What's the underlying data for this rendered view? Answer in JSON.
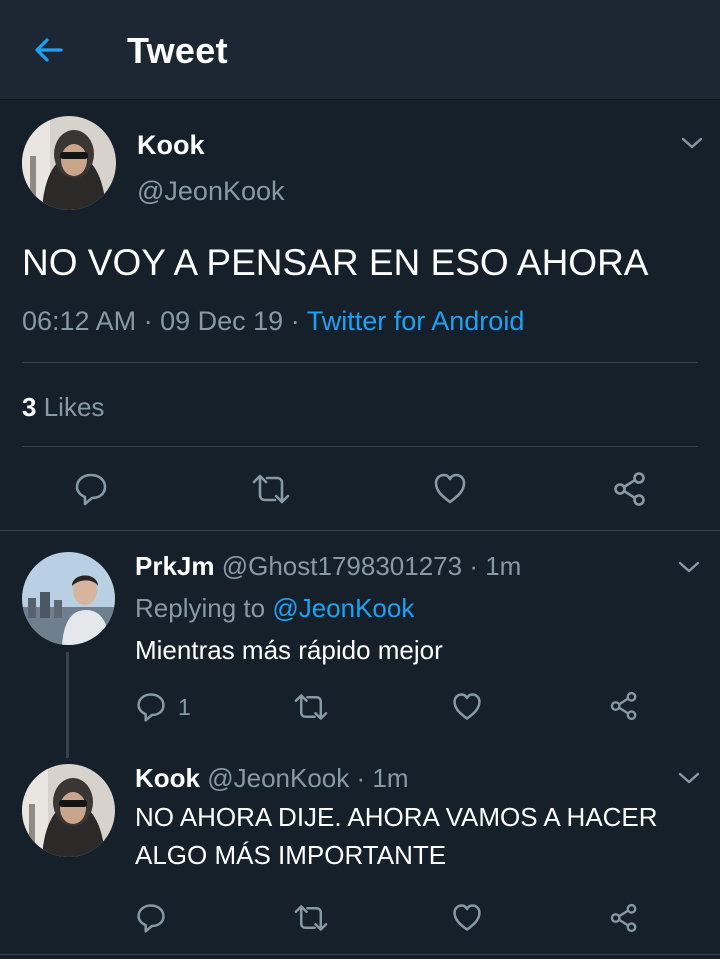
{
  "header": {
    "title": "Tweet"
  },
  "tweet": {
    "author_name": "Kook",
    "author_handle": "@JeonKook",
    "text": "NO VOY A PENSAR EN ESO AHORA",
    "time": "06:12 AM",
    "date": "09 Dec 19",
    "dot": "·",
    "source": "Twitter for Android",
    "likes_count": "3",
    "likes_label": "Likes"
  },
  "replies": [
    {
      "name": "PrkJm",
      "handle": "@Ghost1798301273",
      "age": "· 1m",
      "replying_label": "Replying to",
      "replying_to": "@JeonKook",
      "text": "Mientras más rápido mejor",
      "reply_count": "1"
    },
    {
      "name": "Kook",
      "handle": "@JeonKook",
      "age": "· 1m",
      "text_line1": "NO AHORA DIJE. AHORA VAMOS A HACER",
      "text_line2": "ALGO MÁS IMPORTANTE"
    }
  ],
  "icons": {
    "back": "back-arrow-icon",
    "menu": "chevron-down-icon",
    "reply": "reply-icon",
    "retweet": "retweet-icon",
    "like": "heart-icon",
    "share": "share-icon"
  },
  "colors": {
    "background": "#15202b",
    "header": "#1c2733",
    "accent": "#1da1f2",
    "muted": "#8899a6",
    "divider": "#38444d"
  }
}
